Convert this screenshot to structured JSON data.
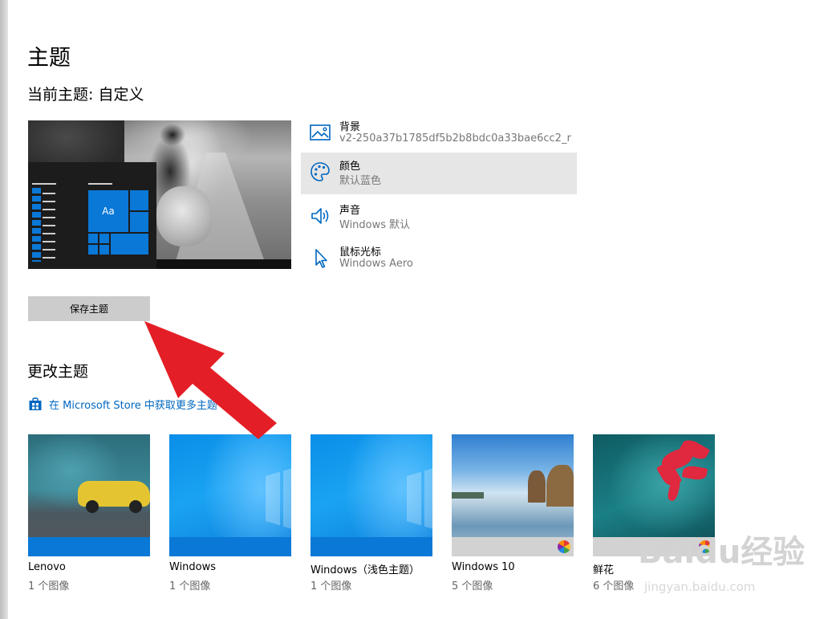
{
  "page": {
    "title": "主题",
    "current_theme": "当前主题: 自定义"
  },
  "settings": [
    {
      "title": "背景",
      "value": "v2-250a37b1785df5b2b8bdc0a33bae6cc2_r",
      "icon": "picture-icon"
    },
    {
      "title": "颜色",
      "value": "默认蓝色",
      "icon": "palette-icon"
    },
    {
      "title": "声音",
      "value": "Windows 默认",
      "icon": "speaker-icon"
    },
    {
      "title": "鼠标光标",
      "value": "Windows Aero",
      "icon": "cursor-icon"
    }
  ],
  "preview": {
    "tile_text": "Aa"
  },
  "save_button": "保存主题",
  "change_theme": {
    "title": "更改主题",
    "store_link": "在 Microsoft Store 中获取更多主题"
  },
  "themes": [
    {
      "name": "Lenovo",
      "count": "1 个图像"
    },
    {
      "name": "Windows",
      "count": "1 个图像"
    },
    {
      "name": "Windows（浅色主题）",
      "count": "1 个图像"
    },
    {
      "name": "Windows 10",
      "count": "5 个图像"
    },
    {
      "name": "鲜花",
      "count": "6 个图像"
    }
  ],
  "watermark": {
    "main": "Baidu经验",
    "sub": "jingyan.baidu.com"
  },
  "colors": {
    "accent": "#0a78d7",
    "link": "#0067c0",
    "arrow": "#e41e26"
  }
}
